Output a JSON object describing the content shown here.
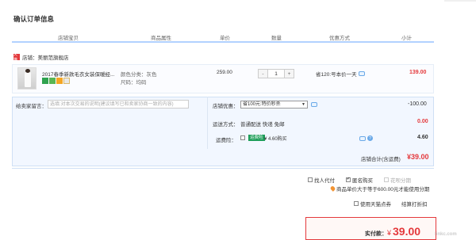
{
  "page": {
    "title": "确认订单信息"
  },
  "table": {
    "headers": [
      "店铺宝贝",
      "商品属性",
      "单价",
      "数量",
      "优惠方式",
      "小计"
    ]
  },
  "shop": {
    "badge": "天猫",
    "label": "店铺：美丽范旗舰店"
  },
  "item": {
    "name": "2017春季新款毛衣女装保暖经...",
    "color": "颜色分类：灰色",
    "size": "尺码：均码",
    "price": "259.00",
    "quantity": "1",
    "qty_minus": "-",
    "qty_plus": "+",
    "discount": "省120:号本价一天",
    "subtotal": "139.00"
  },
  "message": {
    "label": "给卖家留言：",
    "placeholder": "选填:对本次交易的说明(建议填写已和卖家协商一致的内容)"
  },
  "promo": {
    "label": "店铺优惠：",
    "selected": "省100元:特价秒杀",
    "value": "-100.00"
  },
  "shipping": {
    "label": "运送方式：",
    "text": "普通配送 快递 免邮",
    "value": "0.00"
  },
  "insurance": {
    "label": "运费险：",
    "badge": "运费险",
    "text": "¥ 4.60购买",
    "value": "4.60"
  },
  "shop_total": {
    "label": "店铺合计(含运费)",
    "value": "¥39.00"
  },
  "pay_options": {
    "anon_pay": "找人代付",
    "anon_buy": "匿名购买",
    "huabei": "花呗分期",
    "notice": "商品单价大于等于600.00元才能使用分期"
  },
  "footer": {
    "tmall_coupon": "使用天猫点券",
    "settle": "结算打折扣",
    "pay_label": "实付款：",
    "pay_currency": "¥",
    "pay_value": "39.00",
    "watermark": "linkc.com"
  },
  "colors": {
    "accent_red": "#e4393c",
    "header_line": "#b2d1ff",
    "panel_bg": "#f2f7ff"
  }
}
